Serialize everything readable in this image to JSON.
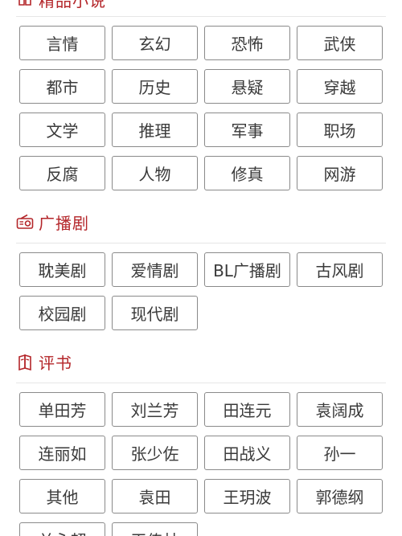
{
  "sections": [
    {
      "title": "精品小说",
      "icon": "book-icon",
      "tags": [
        "言情",
        "玄幻",
        "恐怖",
        "武侠",
        "都市",
        "历史",
        "悬疑",
        "穿越",
        "文学",
        "推理",
        "军事",
        "职场",
        "反腐",
        "人物",
        "修真",
        "网游"
      ]
    },
    {
      "title": "广播剧",
      "icon": "radio-icon",
      "tags": [
        "耽美剧",
        "爱情剧",
        "BL广播剧",
        "古风剧",
        "校园剧",
        "现代剧"
      ]
    },
    {
      "title": "评书",
      "icon": "storytelling-icon",
      "tags": [
        "单田芳",
        "刘兰芳",
        "田连元",
        "袁阔成",
        "连丽如",
        "张少佐",
        "田战义",
        "孙一",
        "其他",
        "袁田",
        "王玥波",
        "郭德纲",
        "关永超",
        "王传林"
      ]
    }
  ],
  "colors": {
    "accent": "#b4262a",
    "border": "#8a8a8a",
    "text": "#3a3a3a"
  }
}
